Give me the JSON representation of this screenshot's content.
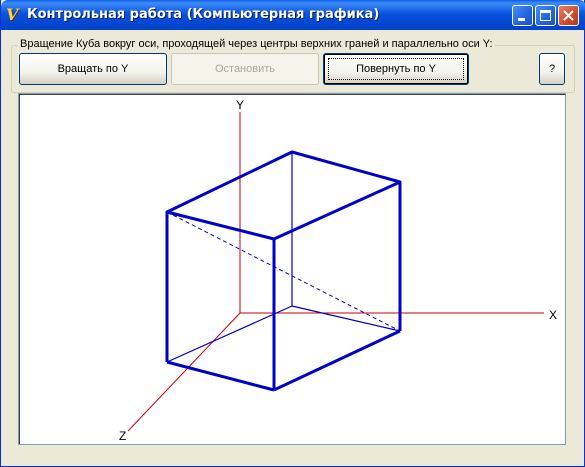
{
  "window": {
    "title": "Контрольная работа (Компьютерная графика)",
    "icon": "delphi-app-icon",
    "icon_glyph": "V",
    "controls": {
      "minimize": "minimize-icon",
      "maximize": "maximize-icon",
      "close": "close-icon"
    }
  },
  "group": {
    "label": "Вращение Куба вокруг оси, проходящей через центры верхних граней и параллельно оси Y:"
  },
  "buttons": {
    "rotate": "Вращать по Y",
    "stop": "Остановить",
    "turn": "Повернуть по Y",
    "help": "?"
  },
  "canvas": {
    "axis_labels": {
      "x": "X",
      "y": "Y",
      "z": "Z"
    },
    "colors": {
      "axis": "#cc0000",
      "cube": "#0000cc",
      "background": "#ffffff"
    }
  }
}
